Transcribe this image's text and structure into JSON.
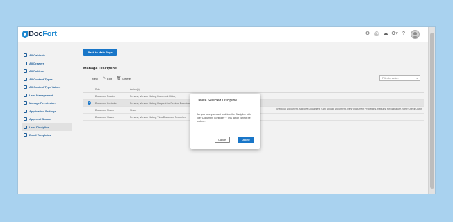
{
  "app": {
    "logo_part1": "Doc",
    "logo_part2": "Fort",
    "top_icons": [
      "settings-icon",
      "bell-icon",
      "cloud-icon",
      "gear-icon",
      "help-icon"
    ]
  },
  "sidebar": {
    "items": [
      {
        "label": "All Cabinets",
        "active": false
      },
      {
        "label": "All Drawers",
        "active": false
      },
      {
        "label": "All Folders",
        "active": false
      },
      {
        "label": "All Content Types",
        "active": false
      },
      {
        "label": "All Content Type Values",
        "active": false
      },
      {
        "label": "User Management",
        "active": false
      },
      {
        "label": "Manage Permission",
        "active": false
      },
      {
        "label": "Application Settings",
        "active": false
      },
      {
        "label": "Approval Status",
        "active": false
      },
      {
        "label": "User Discipline",
        "active": true
      },
      {
        "label": "Email Templates",
        "active": false
      }
    ]
  },
  "main": {
    "back_button": "Back to Main Page",
    "section_title": "Manage Discipline",
    "toolbar": {
      "new": "New",
      "edit": "Edit",
      "delete": "Delete"
    },
    "filter_placeholder": "Filter by action",
    "table": {
      "headers": [
        "Role",
        "Action(s)"
      ],
      "rows": [
        {
          "role": "Document Reader",
          "actions": "Preview, Version History, Document History",
          "selected": false
        },
        {
          "role": "Document Controller",
          "actions": "Preview, Version History, Request for Review, Download Document",
          "selected": true
        },
        {
          "role": "Document Sharer",
          "actions": "Share",
          "selected": false
        },
        {
          "role": "Document Viewer",
          "actions": "Preview, Version History, View Document Properties",
          "selected": false
        }
      ],
      "selected_row_overflow": "Checkout Document, Approve Document, Can Upload Document, View Document Properties, Request for Signature, View Check Out In"
    }
  },
  "modal": {
    "title": "Delete Selected Discipline",
    "body": "Are you sure you want to delete the Discipline with role \"Document Controller\"? This action cannot be undone.",
    "cancel": "Cancel",
    "delete": "Delete"
  },
  "colors": {
    "background": "#a9d2ef",
    "accent": "#1976c8",
    "sidebar_text": "#1f5f9a"
  }
}
